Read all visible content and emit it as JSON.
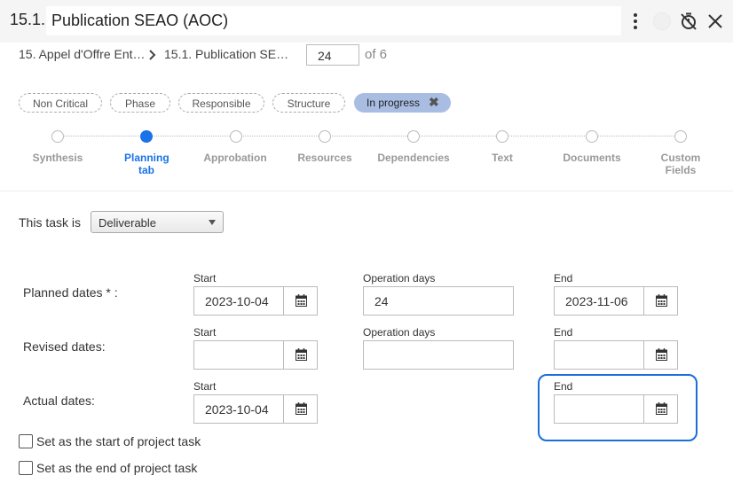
{
  "header": {
    "prefix": "15.1.",
    "title": "Publication SEAO (AOC)",
    "icons": [
      "more-vertical-icon",
      "status-circle-icon",
      "timer-off-icon",
      "close-icon"
    ]
  },
  "breadcrumb": {
    "parent": "15. Appel d'Offre Ent…",
    "current": "15.1. Publication SE…",
    "page_value": "24",
    "page_of": "of 6"
  },
  "tags": [
    {
      "label": "Non Critical"
    },
    {
      "label": "Phase"
    },
    {
      "label": "Responsible"
    },
    {
      "label": "Structure"
    }
  ],
  "status_tag": {
    "label": "In progress",
    "remove": "✖"
  },
  "steps": [
    {
      "label": "Synthesis",
      "active": false
    },
    {
      "label": "Planning tab",
      "active": true
    },
    {
      "label": "Approbation",
      "active": false
    },
    {
      "label": "Resources",
      "active": false
    },
    {
      "label": "Dependencies",
      "active": false
    },
    {
      "label": "Text",
      "active": false
    },
    {
      "label": "Documents",
      "active": false
    },
    {
      "label": "Custom Fields",
      "active": false
    }
  ],
  "task": {
    "label": "This task is",
    "selected": "Deliverable"
  },
  "dates": {
    "col_start": "Start",
    "col_days": "Operation days",
    "col_end": "End",
    "planned": {
      "label": "Planned dates * :",
      "start": "2023-10-04",
      "days": "24",
      "end": "2023-11-06"
    },
    "revised": {
      "label": "Revised dates:",
      "start": "",
      "days": "",
      "end": ""
    },
    "actual": {
      "label": "Actual dates:",
      "start": "2023-10-04",
      "end": ""
    }
  },
  "options": {
    "start_of_project": "Set as the start of project task",
    "end_of_project": "Set as the end of project task"
  },
  "colors": {
    "accent": "#1a73e8",
    "status_tag": "#a9bde3",
    "highlight": "#1a6fd8"
  }
}
